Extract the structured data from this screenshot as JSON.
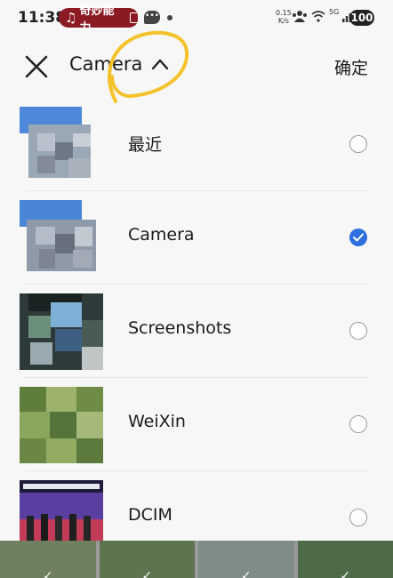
{
  "status": {
    "time": "11:38",
    "pill_text": "奇妙能力",
    "speed_value": "0.15",
    "speed_unit": "K/s",
    "network": "5G",
    "battery": "100"
  },
  "header": {
    "title": "Camera",
    "confirm_label": "确定"
  },
  "albums": [
    {
      "label": "最近",
      "selected": false
    },
    {
      "label": "Camera",
      "selected": true
    },
    {
      "label": "Screenshots",
      "selected": false
    },
    {
      "label": "WeiXin",
      "selected": false
    },
    {
      "label": "DCIM",
      "selected": false
    }
  ],
  "colors": {
    "accent": "#2e6fe0",
    "pill": "#8b1a22",
    "scribble": "#f4c22b"
  }
}
